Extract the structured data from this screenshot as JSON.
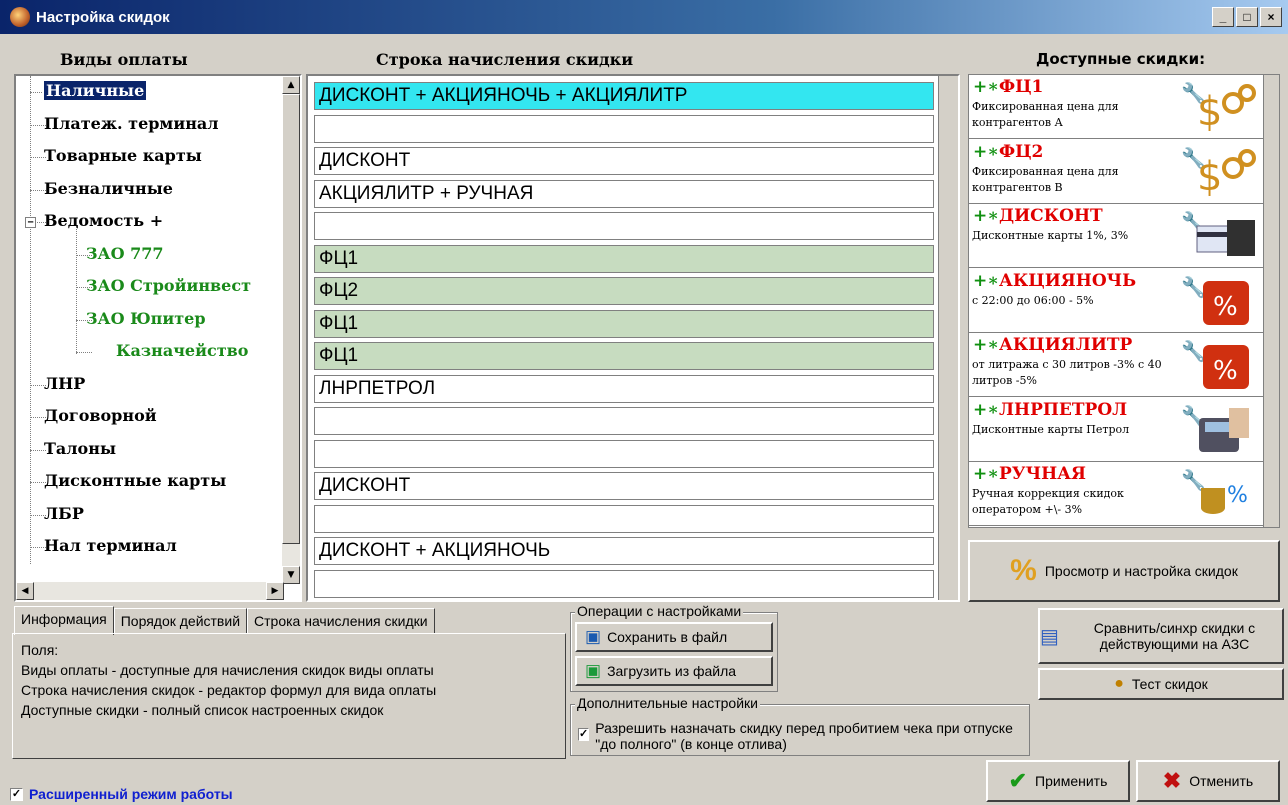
{
  "window": {
    "title": "Настройка скидок",
    "controls": [
      "_",
      "□",
      "×"
    ]
  },
  "headers": {
    "payment_types": "Виды оплаты",
    "formula": "Строка начисления скидки",
    "available": "Доступные скидки:"
  },
  "tree": [
    {
      "label": "Наличные",
      "level": 0,
      "selected": true
    },
    {
      "label": "Платеж. терминал",
      "level": 0
    },
    {
      "label": "Товарные карты",
      "level": 0
    },
    {
      "label": "Безналичные",
      "level": 0
    },
    {
      "label": "Ведомость +",
      "level": 0,
      "expander": "−"
    },
    {
      "label": "ЗАО 777",
      "level": 1
    },
    {
      "label": "ЗАО Стройинвест",
      "level": 1
    },
    {
      "label": "ЗАО Юпитер",
      "level": 1
    },
    {
      "label": "Казначейство",
      "level": 1
    },
    {
      "label": "ЛНР",
      "level": 0
    },
    {
      "label": "Договорной",
      "level": 0
    },
    {
      "label": "Талоны",
      "level": 0
    },
    {
      "label": "Дисконтные карты",
      "level": 0
    },
    {
      "label": "ЛБР",
      "level": 0
    },
    {
      "label": "Нал терминал",
      "level": 0
    }
  ],
  "formulas": [
    {
      "text": "ДИСКОНТ + АКЦИЯНОЧЬ + АКЦИЯЛИТР",
      "style": "cyan"
    },
    {
      "text": "",
      "style": "white"
    },
    {
      "text": "ДИСКОНТ",
      "style": "white"
    },
    {
      "text": "АКЦИЯЛИТР + РУЧНАЯ",
      "style": "white"
    },
    {
      "text": "",
      "style": "white"
    },
    {
      "text": "ФЦ1",
      "style": "green"
    },
    {
      "text": "ФЦ2",
      "style": "green"
    },
    {
      "text": "ФЦ1",
      "style": "green"
    },
    {
      "text": "ФЦ1",
      "style": "green"
    },
    {
      "text": "ЛНРПЕТРОЛ",
      "style": "white"
    },
    {
      "text": "",
      "style": "white"
    },
    {
      "text": "",
      "style": "white"
    },
    {
      "text": "ДИСКОНТ",
      "style": "white"
    },
    {
      "text": "",
      "style": "white"
    },
    {
      "text": "ДИСКОНТ + АКЦИЯНОЧЬ",
      "style": "white"
    },
    {
      "text": "",
      "style": "white"
    }
  ],
  "discounts": [
    {
      "prefix": "+∗",
      "name": "ФЦ1",
      "desc": "Фиксированная цена для контрагентов А",
      "icon": "chain-dollar-icon"
    },
    {
      "prefix": "+∗",
      "name": "ФЦ2",
      "desc": "Фиксированная цена для контрагентов В",
      "icon": "chain-dollar-icon"
    },
    {
      "prefix": "+∗",
      "name": "ДИСКОНТ",
      "desc": "Дисконтные карты 1%, 3%",
      "icon": "card-reader-icon"
    },
    {
      "prefix": "+∗",
      "name": "АКЦИЯНОЧЬ",
      "desc": "с 22:00 до 06:00 - 5%",
      "icon": "percent-dice-icon"
    },
    {
      "prefix": "+∗",
      "name": "АКЦИЯЛИТР",
      "desc": "от литража с 30 литров -3% с 40 литров -5%",
      "icon": "percent-dice-icon"
    },
    {
      "prefix": "+∗",
      "name": "ЛНРПЕТРОЛ",
      "desc": "Дисконтные карты Петрол",
      "icon": "pos-terminal-icon"
    },
    {
      "prefix": "+∗",
      "name": "РУЧНАЯ",
      "desc": "Ручная коррекция скидок оператором +\\- 3%",
      "icon": "coins-percent-icon"
    }
  ],
  "buttons": {
    "view_setup": "Просмотр и настройка скидок",
    "save_file": "Сохранить в файл",
    "load_file": "Загрузить из файла",
    "compare_sync": "Сравнить/синхр скидки с действующими на АЗС",
    "test": "Тест скидок",
    "apply": "Применить",
    "cancel": "Отменить"
  },
  "tabs": [
    "Информация",
    "Порядок действий",
    "Строка начисления скидки"
  ],
  "info_lines": [
    "Поля:",
    "Виды оплаты - доступные для начисления скидок виды оплаты",
    "Строка начисления скидок - редактор формул для вида оплаты",
    "Доступные скидки - полный список настроенных скидок"
  ],
  "groups": {
    "ops": "Операции с настройками",
    "extra": "Дополнительные настройки"
  },
  "extra_checkbox": {
    "label": "Разрешить назначать скидку перед пробитием чека при отпуске \"до полного\" (в конце отлива)",
    "checked": true
  },
  "extended_mode": {
    "label": "Расширенный режим работы",
    "checked": true
  },
  "colors": {
    "selected": "#0a246a",
    "cyan_row": "#33e6f0",
    "green_row": "#c7dcc0",
    "discount_name": "#e00000",
    "green_text": "#1a8a1a"
  }
}
